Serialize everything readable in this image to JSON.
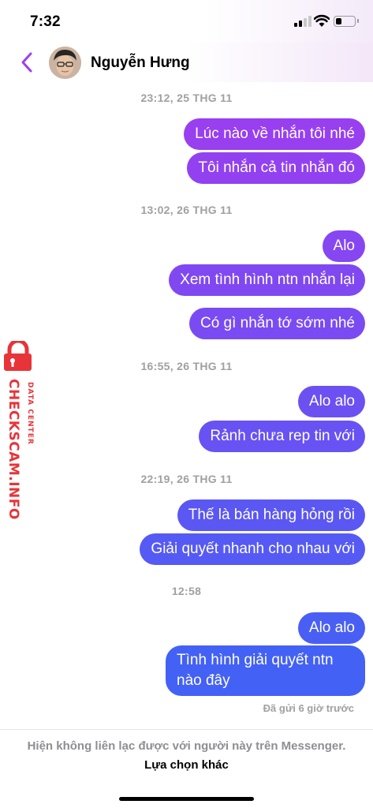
{
  "status_bar": {
    "time": "7:32",
    "signal_bars_active": 2,
    "battery_level": 0.35
  },
  "header": {
    "contact_name": "Nguyễn Hưng",
    "back_icon": "chevron-left-icon",
    "accent_color": "#9d3ef2"
  },
  "messages": {
    "groups": [
      {
        "timestamp": "23:12, 25 THG 11",
        "bubbles": [
          "Lúc nào về nhắn tôi nhé",
          "Tôi nhắn cả tin nhắn đó"
        ]
      },
      {
        "timestamp": "13:02, 26 THG 11",
        "bubbles": [
          "Alo",
          "Xem tình hình ntn nhắn lại",
          "Có gì nhắn tớ sớm nhé"
        ]
      },
      {
        "timestamp": "16:55, 26 THG 11",
        "bubbles": [
          "Alo alo",
          "Rảnh chưa rep tin với"
        ]
      },
      {
        "timestamp": "22:19, 26 THG 11",
        "bubbles": [
          "Thế là bán hàng hỏng rồi",
          "Giải quyết nhanh cho nhau với"
        ]
      },
      {
        "timestamp": "12:58",
        "bubbles": [
          "Alo alo",
          "Tình hình giải quyết ntn nào đây"
        ]
      }
    ],
    "sent_status": "Đã gửi 6 giờ trước"
  },
  "watermark": {
    "brand": "CHECKSCAM.INFO",
    "subtitle": "DATA CENTER",
    "color": "#e63439"
  },
  "footer": {
    "notice": "Hiện không liên lạc được với người này trên Messenger.",
    "link_label": "Lựa chọn khác"
  },
  "colors": {
    "bubble_top": "#9a3ef0",
    "bubble_bottom": "#3f63f5",
    "timestamp": "#a0a0a0"
  }
}
